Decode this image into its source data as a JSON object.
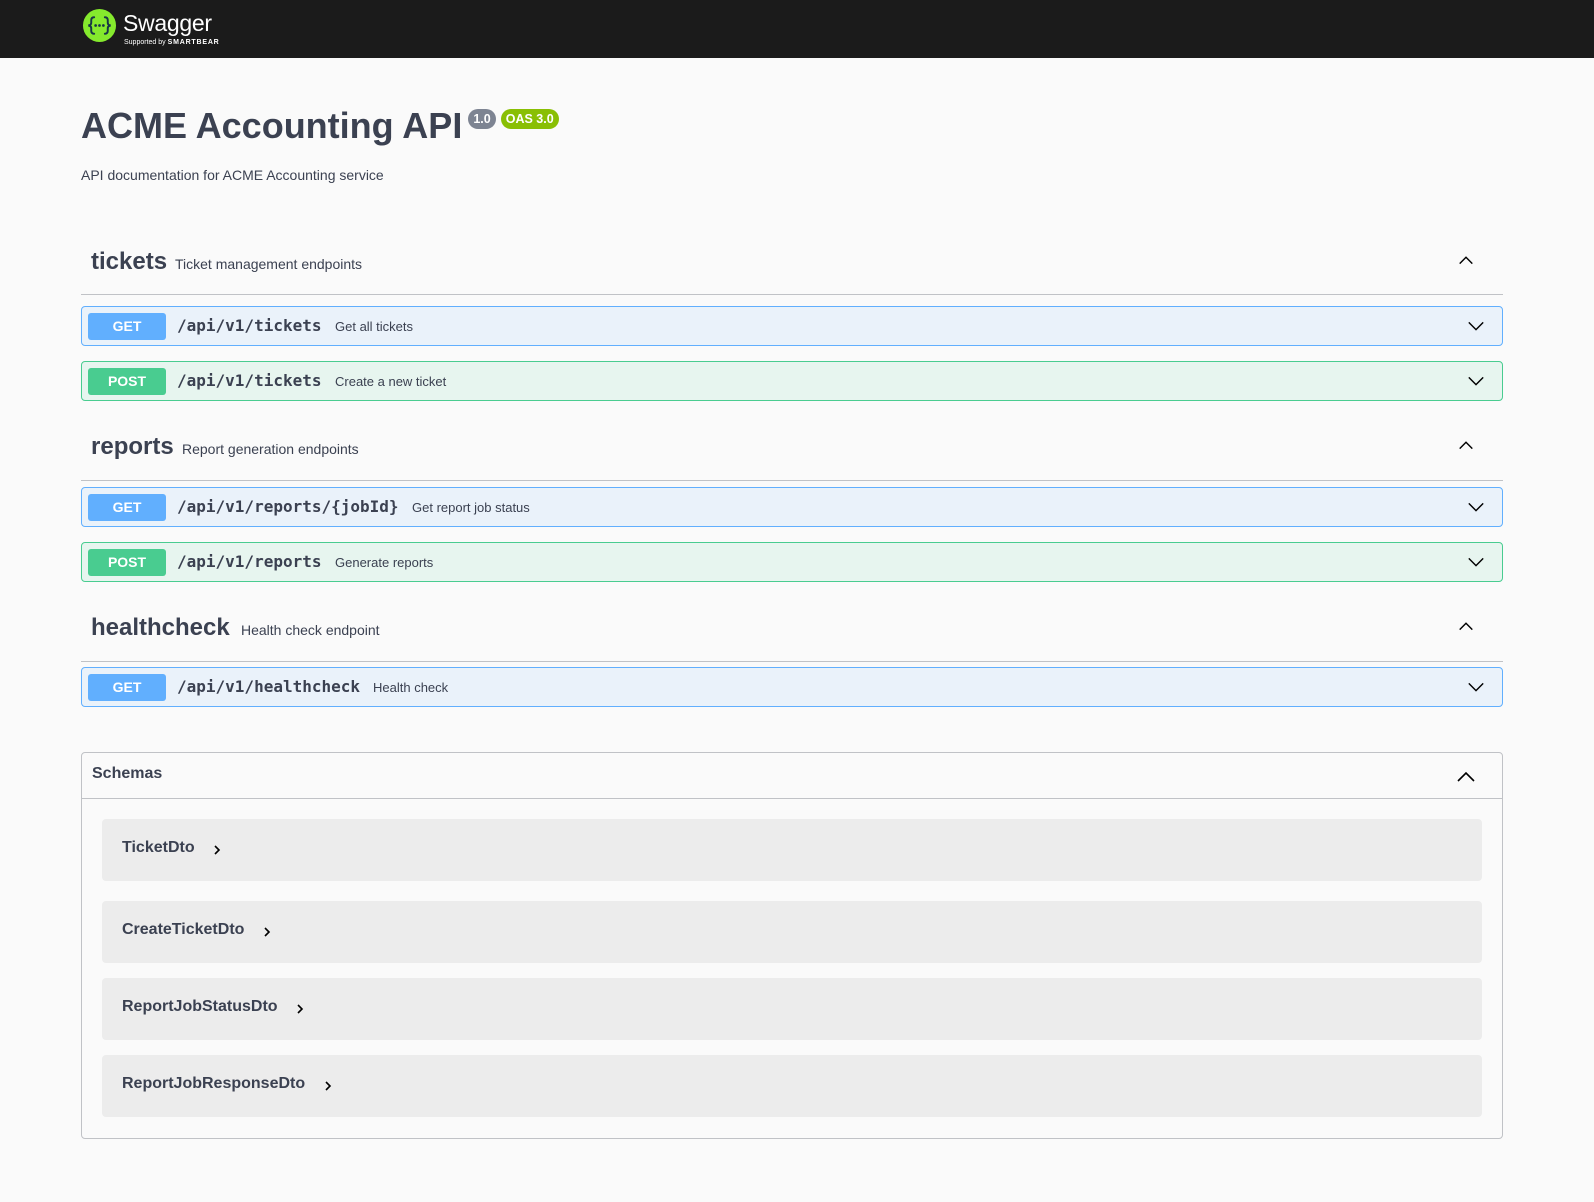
{
  "header": {
    "brand_name": "Swagger",
    "brand_sub_prefix": "Supported by",
    "brand_sub_company": "SMARTBEAR",
    "brand_color": "#85ea2d"
  },
  "info": {
    "title": "ACME Accounting API",
    "version": "1.0",
    "oas": "OAS 3.0",
    "description": "API documentation for ACME Accounting service"
  },
  "tags": [
    {
      "name": "tickets",
      "description": "Ticket management endpoints",
      "operations": [
        {
          "method": "GET",
          "path": "/api/v1/tickets",
          "summary": "Get all tickets"
        },
        {
          "method": "POST",
          "path": "/api/v1/tickets",
          "summary": "Create a new ticket"
        }
      ]
    },
    {
      "name": "reports",
      "description": "Report generation endpoints",
      "operations": [
        {
          "method": "GET",
          "path": "/api/v1/reports/{jobId}",
          "summary": "Get report job status"
        },
        {
          "method": "POST",
          "path": "/api/v1/reports",
          "summary": "Generate reports"
        }
      ]
    },
    {
      "name": "healthcheck",
      "description": "Health check endpoint",
      "operations": [
        {
          "method": "GET",
          "path": "/api/v1/healthcheck",
          "summary": "Health check"
        }
      ]
    }
  ],
  "schemas": {
    "title": "Schemas",
    "items": [
      "TicketDto",
      "CreateTicketDto",
      "ReportJobStatusDto",
      "ReportJobResponseDto"
    ]
  },
  "colors": {
    "get": "#61affe",
    "post": "#49cc90",
    "text": "#3b4151",
    "topbar": "#1b1b1b"
  },
  "icons": {
    "logo": "swagger-logo-icon",
    "collapse": "chevron-up-icon",
    "expand": "chevron-down-icon",
    "model_expand": "chevron-right-icon"
  }
}
